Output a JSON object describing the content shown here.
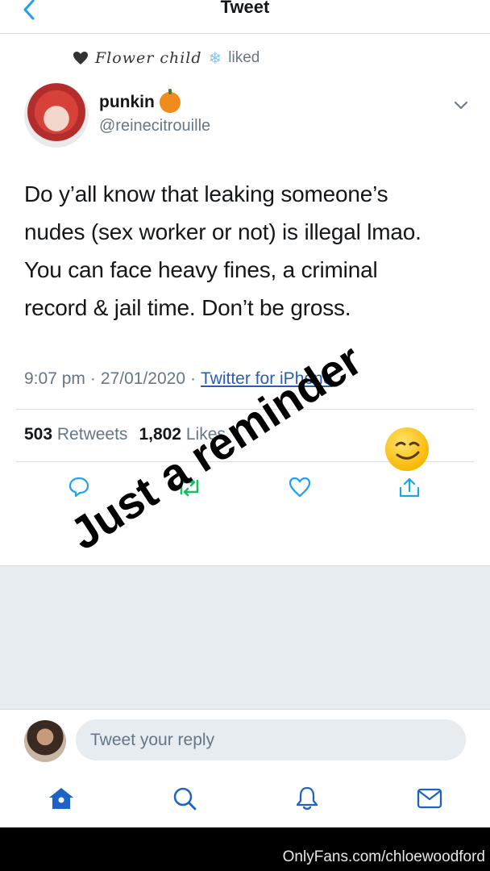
{
  "header": {
    "title": "Tweet",
    "back_icon": "chevron-left-icon"
  },
  "social_context": {
    "icon": "heart-icon",
    "name": "Flower child",
    "name_emoji": "❄",
    "action": "liked"
  },
  "tweet": {
    "author_name": "punkin",
    "author_emoji": "pumpkin-icon",
    "handle": "@reinecitrouille",
    "text_lines": [
      "Do y’all know that leaking someone’s",
      "nudes (sex worker or not) is illegal lmao.",
      "You can face heavy fines, a criminal",
      "record & jail time. Don’t be gross."
    ],
    "time": "9:07 pm",
    "separator": "·",
    "date": "27/01/2020",
    "source": "Twitter for iPhone",
    "retweets_count": "503",
    "retweets_label": "Retweets",
    "likes_count": "1,802",
    "likes_label": "Likes"
  },
  "actions": [
    "reply-icon",
    "retweet-icon",
    "like-icon",
    "share-icon"
  ],
  "overlay": {
    "sticker_text": "Just a reminder",
    "emoji": "smirking-face"
  },
  "reply": {
    "placeholder": "Tweet your reply"
  },
  "tabs": [
    "home-icon",
    "search-icon",
    "notifications-icon",
    "messages-icon"
  ],
  "watermark": "OnlyFans.com/chloewoodford",
  "colors": {
    "accent": "#1da1f2",
    "retweet_green": "#17bf63",
    "text": "#14171a",
    "secondary": "#657786",
    "gray_bg": "#e6ecf0",
    "link": "#2a5db0"
  }
}
